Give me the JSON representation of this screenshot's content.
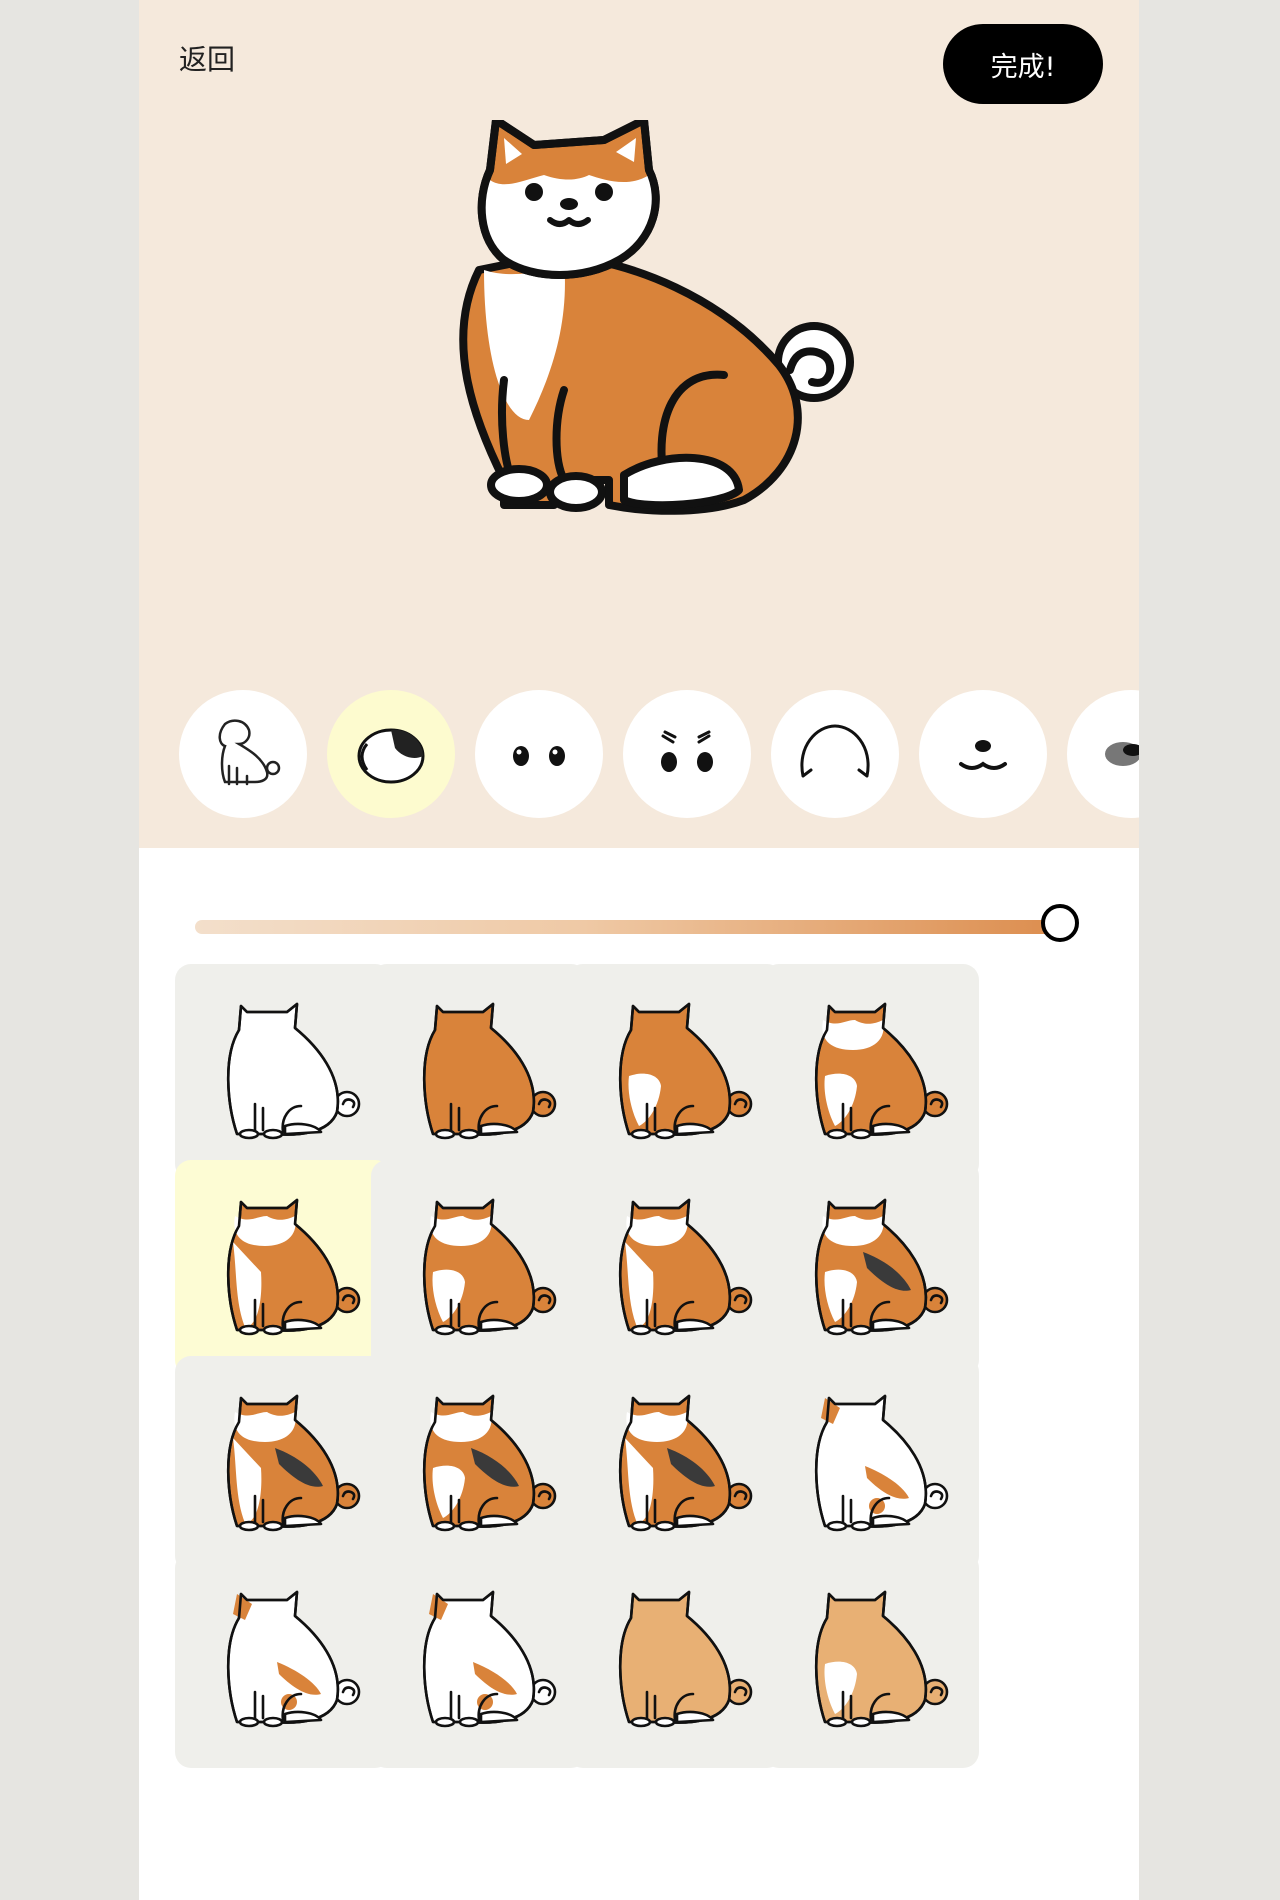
{
  "header": {
    "back_label": "返回",
    "done_label": "完成!"
  },
  "preview": {
    "base_color": "#d9833a",
    "white_color": "#ffffff",
    "outline_color": "#111111"
  },
  "part_tabs": [
    {
      "icon": "dog-body-icon",
      "selected": false
    },
    {
      "icon": "head-pattern-icon",
      "selected": true
    },
    {
      "icon": "eyes-icon",
      "selected": false
    },
    {
      "icon": "eyebrows-icon",
      "selected": false
    },
    {
      "icon": "ears-icon",
      "selected": false
    },
    {
      "icon": "mouth-icon",
      "selected": false
    },
    {
      "icon": "nose-icon",
      "selected": false
    }
  ],
  "slider": {
    "value": 1.0
  },
  "color_options": [
    {
      "base": "#ffffff",
      "pattern": "none",
      "selected": false
    },
    {
      "base": "#d9833a",
      "pattern": "none",
      "selected": false
    },
    {
      "base": "#d9833a",
      "pattern": "chest",
      "selected": false
    },
    {
      "base": "#d9833a",
      "pattern": "face-chest",
      "selected": false
    },
    {
      "base": "#d9833a",
      "pattern": "face-wide",
      "selected": true
    },
    {
      "base": "#d9833a",
      "pattern": "face-chest",
      "selected": false
    },
    {
      "base": "#d9833a",
      "pattern": "face-wide",
      "selected": false
    },
    {
      "base": "#d9833a",
      "pattern": "face-chest-black",
      "selected": false
    },
    {
      "base": "#d9833a",
      "pattern": "face-wide-black",
      "selected": false
    },
    {
      "base": "#d9833a",
      "pattern": "face-chest-black",
      "selected": false
    },
    {
      "base": "#d9833a",
      "pattern": "face-wide-black",
      "selected": false
    },
    {
      "base": "#ffffff",
      "pattern": "orange-patches",
      "selected": false
    },
    {
      "base": "#ffffff",
      "pattern": "orange-patches",
      "selected": false
    },
    {
      "base": "#ffffff",
      "pattern": "orange-patches",
      "selected": false
    },
    {
      "base": "#e8b074",
      "pattern": "none",
      "selected": false
    },
    {
      "base": "#e8b074",
      "pattern": "chest",
      "selected": false
    }
  ]
}
